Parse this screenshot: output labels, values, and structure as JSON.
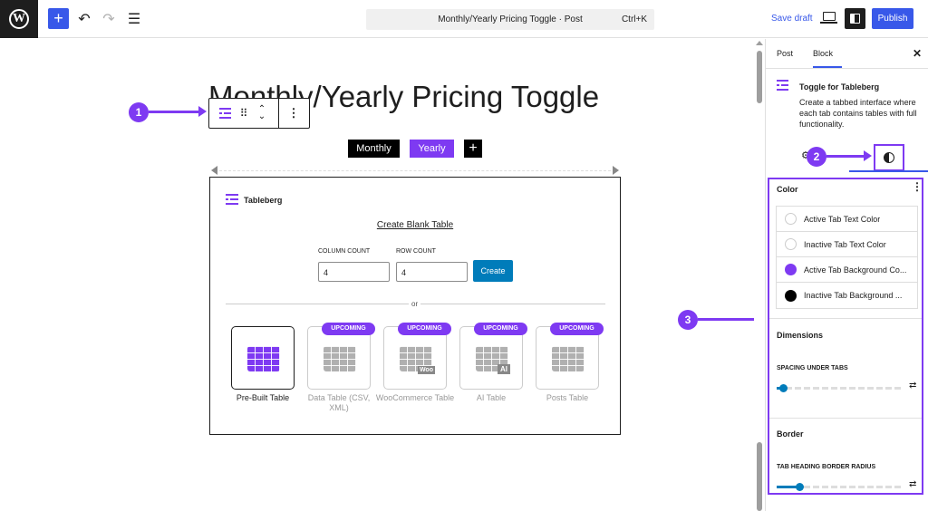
{
  "topbar": {
    "logo_letter": "W",
    "add_glyph": "+",
    "undo_glyph": "↶",
    "redo_glyph": "↷",
    "list_glyph": "☰",
    "command_title": "Monthly/Yearly Pricing Toggle · Post",
    "command_shortcut": "Ctrl+K",
    "save_draft": "Save draft",
    "publish": "Publish"
  },
  "editor": {
    "post_title": "Monthly/Yearly Pricing Toggle",
    "tabs": {
      "monthly": "Monthly",
      "yearly": "Yearly",
      "add": "+"
    },
    "toolbar": {
      "drag_glyph": "⠿",
      "up_glyph": "⌃",
      "down_glyph": "⌄",
      "more_glyph": "⋮"
    },
    "tableberg": {
      "brand": "Tableberg",
      "create_blank": "Create Blank Table",
      "column_label": "COLUMN COUNT",
      "row_label": "ROW COUNT",
      "column_value": "4",
      "row_value": "4",
      "create_button": "Create",
      "or": "or",
      "badge": "UPCOMING",
      "tiles": [
        {
          "label": "Pre-Built Table",
          "icon": "prebuilt-table-icon"
        },
        {
          "label": "Data Table (CSV, XML)",
          "icon": "data-table-icon"
        },
        {
          "label": "WooCommerce Table",
          "icon": "woocommerce-table-icon",
          "glyph": "Woo"
        },
        {
          "label": "AI Table",
          "icon": "ai-table-icon",
          "glyph": "AI"
        },
        {
          "label": "Posts Table",
          "icon": "posts-table-icon"
        }
      ]
    }
  },
  "annotations": [
    "1",
    "2",
    "3"
  ],
  "sidebar": {
    "tab_post": "Post",
    "tab_block": "Block",
    "close_glyph": "✕",
    "block_title": "Toggle for Tableberg",
    "block_description": "Create a tabbed interface where each tab contains tables with full functionality.",
    "gear_glyph": "⚙",
    "color_section": "Color",
    "colors": [
      {
        "label": "Active Tab Text Color",
        "swatch": "#ffffff"
      },
      {
        "label": "Inactive Tab Text Color",
        "swatch": "#ffffff"
      },
      {
        "label": "Active Tab Background Co...",
        "swatch": "#7e3af2"
      },
      {
        "label": "Inactive Tab Background ...",
        "swatch": "#000000"
      }
    ],
    "dimensions_section": "Dimensions",
    "spacing_label": "SPACING UNDER TABS",
    "spacing_value": 0.05,
    "border_section": "Border",
    "radius_label": "TAB HEADING BORDER RADIUS",
    "radius_value": 0.18,
    "custom_glyph": "⇄"
  },
  "colors": {
    "accent": "#3858e9",
    "purple": "#7e3af2",
    "create_blue": "#007cba"
  }
}
